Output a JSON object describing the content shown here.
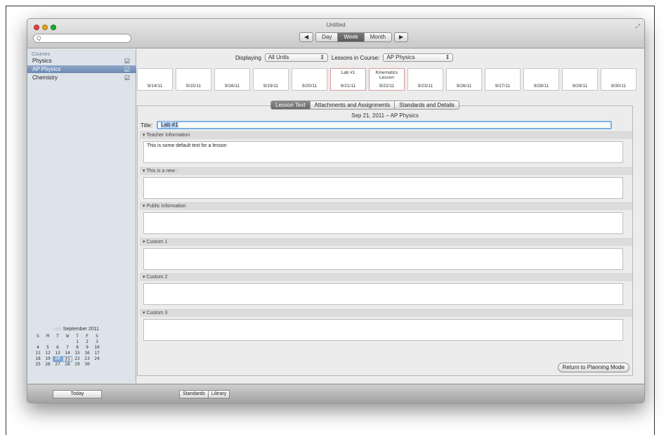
{
  "window": {
    "title": "Untitled",
    "traffic_colors": [
      "#e0443e",
      "#dea123",
      "#1aab29"
    ]
  },
  "toolbar": {
    "search_placeholder": "Q",
    "prev_icon": "◀",
    "next_icon": "▶",
    "views": [
      "Day",
      "Week",
      "Month"
    ],
    "active_view": "Week"
  },
  "sidebar": {
    "heading": "Courses",
    "courses": [
      {
        "name": "Physics",
        "checked": true
      },
      {
        "name": "AP Physics",
        "checked": true,
        "selected": true
      },
      {
        "name": "Chemistry",
        "checked": true
      }
    ]
  },
  "calendar": {
    "title": "September 2011",
    "weekdays": [
      "S",
      "M",
      "T",
      "W",
      "T",
      "F",
      "S"
    ],
    "weeks": [
      [
        "",
        "",
        "",
        "",
        "1",
        "2",
        "3"
      ],
      [
        "4",
        "5",
        "6",
        "7",
        "8",
        "9",
        "10"
      ],
      [
        "11",
        "12",
        "13",
        "14",
        "15",
        "16",
        "17"
      ],
      [
        "18",
        "19",
        "20",
        "21",
        "22",
        "23",
        "24"
      ],
      [
        "25",
        "26",
        "27",
        "28",
        "29",
        "30",
        ""
      ]
    ],
    "highlighted_day": "20",
    "today_day": "21"
  },
  "filters": {
    "displaying_label": "Displaying",
    "displaying_value": "All Units",
    "course_label": "Lessons in Course:",
    "course_value": "AP Physics"
  },
  "week_strip": [
    {
      "date": "9/14/11",
      "lesson": ""
    },
    {
      "date": "9/15/11",
      "lesson": ""
    },
    {
      "date": "9/16/11",
      "lesson": ""
    },
    {
      "date": "9/19/11",
      "lesson": ""
    },
    {
      "date": "9/20/11",
      "lesson": ""
    },
    {
      "date": "9/21/11",
      "lesson": "Lab #1"
    },
    {
      "date": "9/22/11",
      "lesson": "Kinematics Lesson"
    },
    {
      "date": "9/23/11",
      "lesson": ""
    },
    {
      "date": "9/26/11",
      "lesson": ""
    },
    {
      "date": "9/27/11",
      "lesson": ""
    },
    {
      "date": "9/28/11",
      "lesson": ""
    },
    {
      "date": "9/29/11",
      "lesson": ""
    },
    {
      "date": "9/30/11",
      "lesson": ""
    }
  ],
  "tabs": [
    "Lesson Text",
    "Attachments and Assignments",
    "Standards and Details"
  ],
  "active_tab": "Lesson Text",
  "lesson": {
    "header": "Sep 21, 2011 – AP Physics",
    "title_label": "Title:",
    "title_value": "Lab #1",
    "sections": [
      {
        "label": "Teacher Information",
        "text": "This is some default text for a lesson"
      },
      {
        "label": "This is a new :",
        "text": ""
      },
      {
        "label": "Public Information",
        "text": ""
      },
      {
        "label": "Custom 1",
        "text": ""
      },
      {
        "label": "Custom 2",
        "text": ""
      },
      {
        "label": "Custom 3",
        "text": ""
      }
    ]
  },
  "buttons": {
    "return": "Return to Planning Mode",
    "today": "Today",
    "standards": "Standards",
    "library": "Library"
  }
}
